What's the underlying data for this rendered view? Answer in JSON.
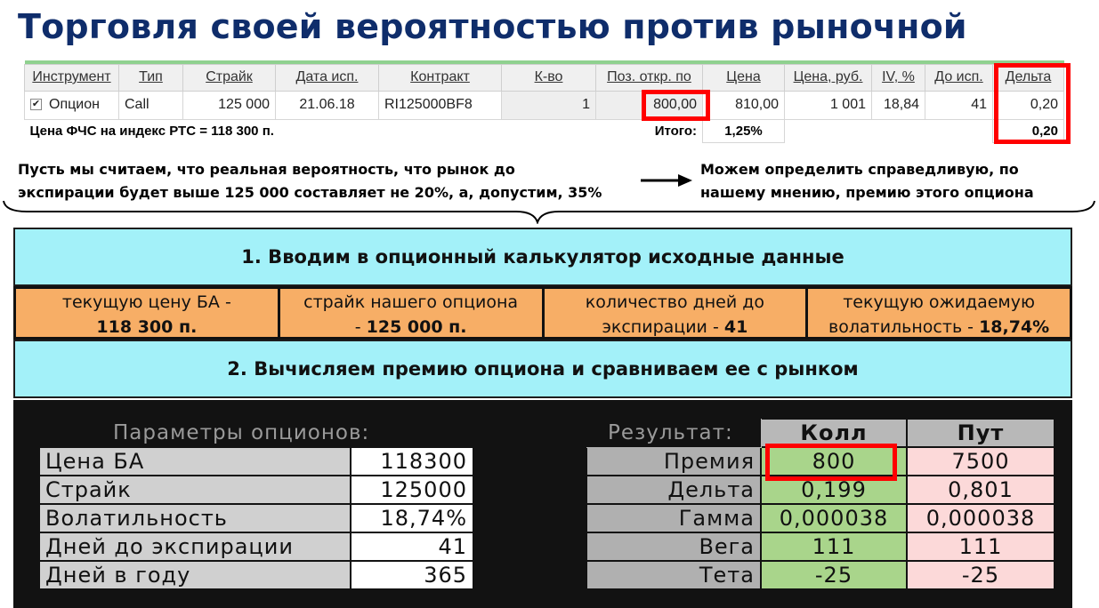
{
  "title": "Торговля своей вероятностью против рыночной",
  "trade_table": {
    "headers": [
      "Инструмент",
      "Тип",
      "Страйк",
      "Дата исп.",
      "Контракт",
      "К-во",
      "Поз. откр. по",
      "Цена",
      "Цена, руб.",
      "IV, %",
      "До исп.",
      "Дельта"
    ],
    "row": {
      "checked": "✔",
      "instrument": "Опцион",
      "type": "Call",
      "strike": "125 000",
      "date": "21.06.18",
      "contract": "RI125000BF8",
      "qty": "1",
      "open_price": "800,00",
      "price": "810,00",
      "price_rub": "1 001",
      "iv": "18,84",
      "days": "41",
      "delta": "0,20"
    },
    "futures_note": "Цена ФЧС на индекс РТС = 118 300 п.",
    "total_label": "Итого:",
    "total_pct": "1,25%",
    "total_delta": "0,20"
  },
  "notes": {
    "left_line1": "Пусть мы считаем, что реальная вероятность, что рынок до",
    "left_line2": "экспирации будет выше 125 000 составляет не 20%, а, допустим, 35%",
    "right_line1": "Можем определить справедливую, по",
    "right_line2": "нашему мнению, премию этого опциона"
  },
  "step1": "1. Вводим в опционный калькулятор исходные данные",
  "inputs": [
    {
      "line1": "текущую цену БА -",
      "bold": "118 300 п.",
      "line2_pre": ""
    },
    {
      "line1": "страйк нашего опциона",
      "bold": "125 000 п.",
      "line2_pre": "- "
    },
    {
      "line1": "количество дней до",
      "bold": "41",
      "line2_pre": "экспирации - "
    },
    {
      "line1": "текущую ожидаемую",
      "bold": "18,74%",
      "line2_pre": "волатильность - "
    }
  ],
  "step2": "2. Вычисляем премию опциона и сравниваем ее с рынком",
  "calculator": {
    "params_title": "Параметры опционов:",
    "params": [
      {
        "label": "Цена БА",
        "value": "118300"
      },
      {
        "label": "Страйк",
        "value": "125000"
      },
      {
        "label": "Волатильность",
        "value": "18,74%"
      },
      {
        "label": "Дней до экспирации",
        "value": "41"
      },
      {
        "label": "Дней в году",
        "value": "365"
      }
    ],
    "results_title": "Результат:",
    "call_header": "Колл",
    "put_header": "Пут",
    "results": [
      {
        "label": "Премия",
        "call": "800",
        "put": "7500"
      },
      {
        "label": "Дельта",
        "call": "0,199",
        "put": "0,801"
      },
      {
        "label": "Гамма",
        "call": "0,000038",
        "put": "0,000038"
      },
      {
        "label": "Вега",
        "call": "111",
        "put": "111"
      },
      {
        "label": "Тета",
        "call": "-25",
        "put": "-25"
      }
    ]
  },
  "colors": {
    "title": "#0f2d6b",
    "highlight": "#ff0000",
    "banner": "#a3f1f9",
    "input_cells": "#f7ae66",
    "call_cells": "#a9d58b",
    "put_cells": "#fcd9d9"
  }
}
